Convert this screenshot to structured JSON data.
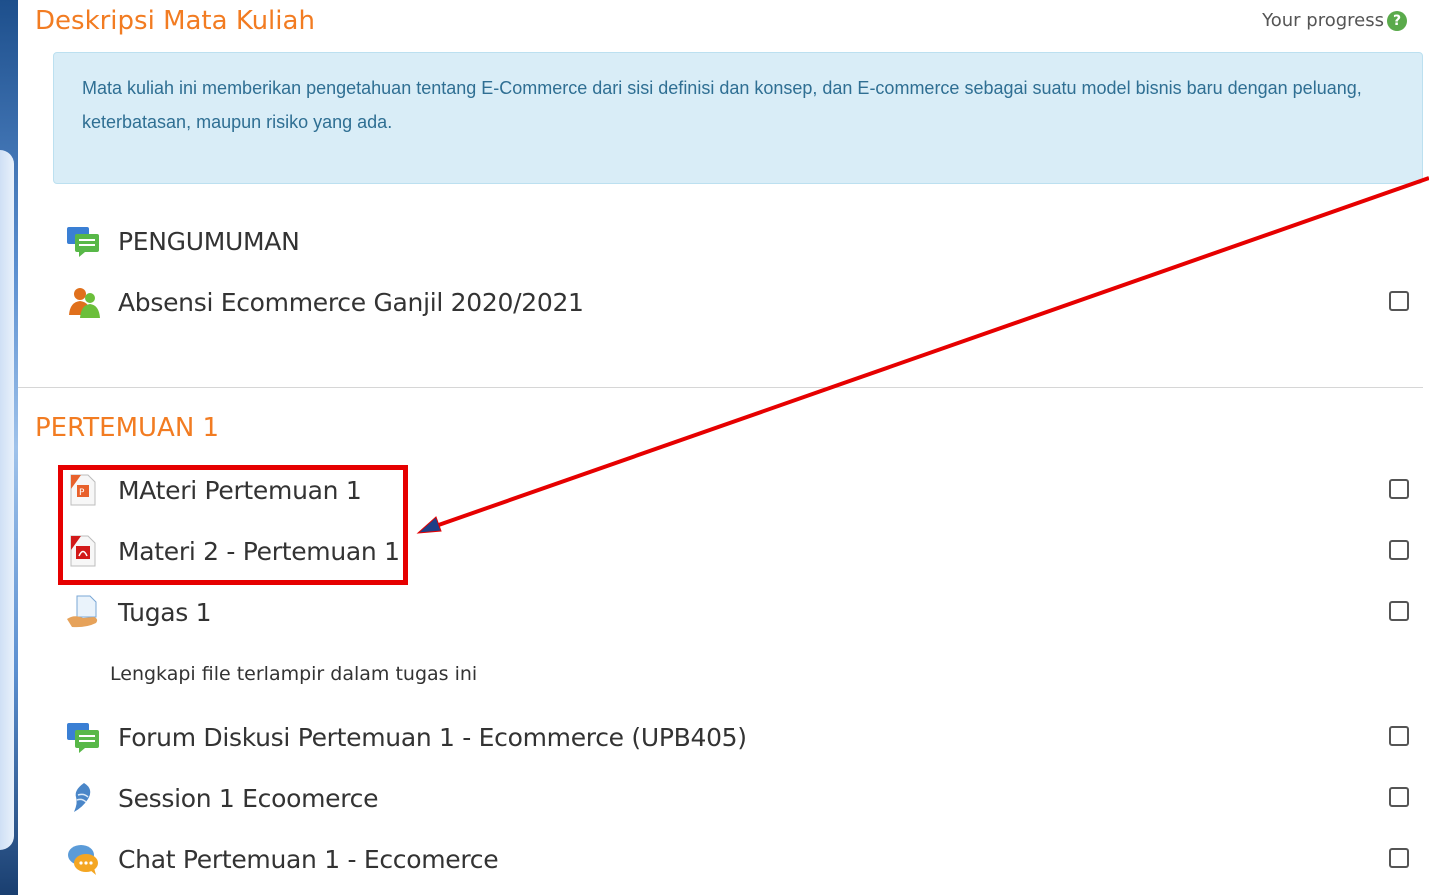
{
  "section0": {
    "title": "Deskripsi Mata Kuliah",
    "progress_label": "Your progress",
    "summary": "Mata kuliah ini memberikan pengetahuan tentang E-Commerce dari sisi definisi dan konsep, dan E-commerce sebagai suatu model bisnis baru dengan peluang, keterbatasan, maupun risiko yang ada.",
    "activities": [
      {
        "label": "PENGUMUMAN",
        "icon": "forum-icon"
      },
      {
        "label": "Absensi Ecommerce Ganjil 2020/2021",
        "icon": "attendance-icon"
      }
    ]
  },
  "section1": {
    "title": "PERTEMUAN 1",
    "activities": [
      {
        "label": "MAteri Pertemuan 1",
        "icon": "powerpoint-icon"
      },
      {
        "label": "Materi 2 - Pertemuan 1",
        "icon": "pdf-icon"
      },
      {
        "label": "Tugas 1",
        "icon": "assignment-icon",
        "description": "Lengkapi file terlampir dalam tugas ini"
      },
      {
        "label": "Forum Diskusi Pertemuan 1 - Ecommerce (UPB405)",
        "icon": "forum-icon"
      },
      {
        "label": "Session 1 Ecoomerce",
        "icon": "bigbluebutton-icon"
      },
      {
        "label": "Chat Pertemuan 1 - Eccomerce",
        "icon": "chat-icon"
      }
    ]
  },
  "colors": {
    "section_title": "#f27c22",
    "summary_bg": "#d9edf7",
    "summary_text": "#2f6f93",
    "annotation": "#e60000"
  }
}
